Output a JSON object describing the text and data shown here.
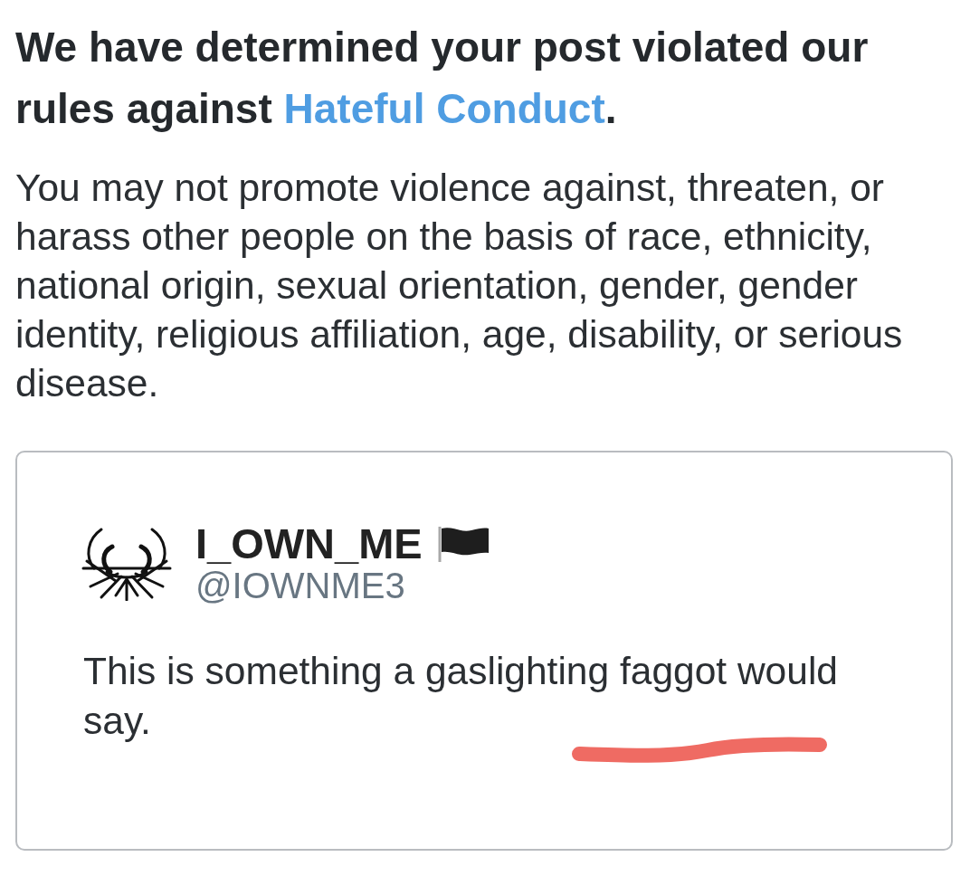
{
  "notice": {
    "heading_before": "We have determined your post violated our rules against ",
    "policy_link": "Hateful Conduct",
    "heading_after": ".",
    "policy_text": "You may not promote violence against, threaten, or harass other people on the basis of race, ethnicity, national origin, sexual orientation, gender, gender identity, religious affiliation, age, disability, or serious disease."
  },
  "reported_post": {
    "display_name": "I_OWN_ME",
    "handle": "@IOWNME3",
    "text": "This is something a gaslighting faggot would say."
  }
}
